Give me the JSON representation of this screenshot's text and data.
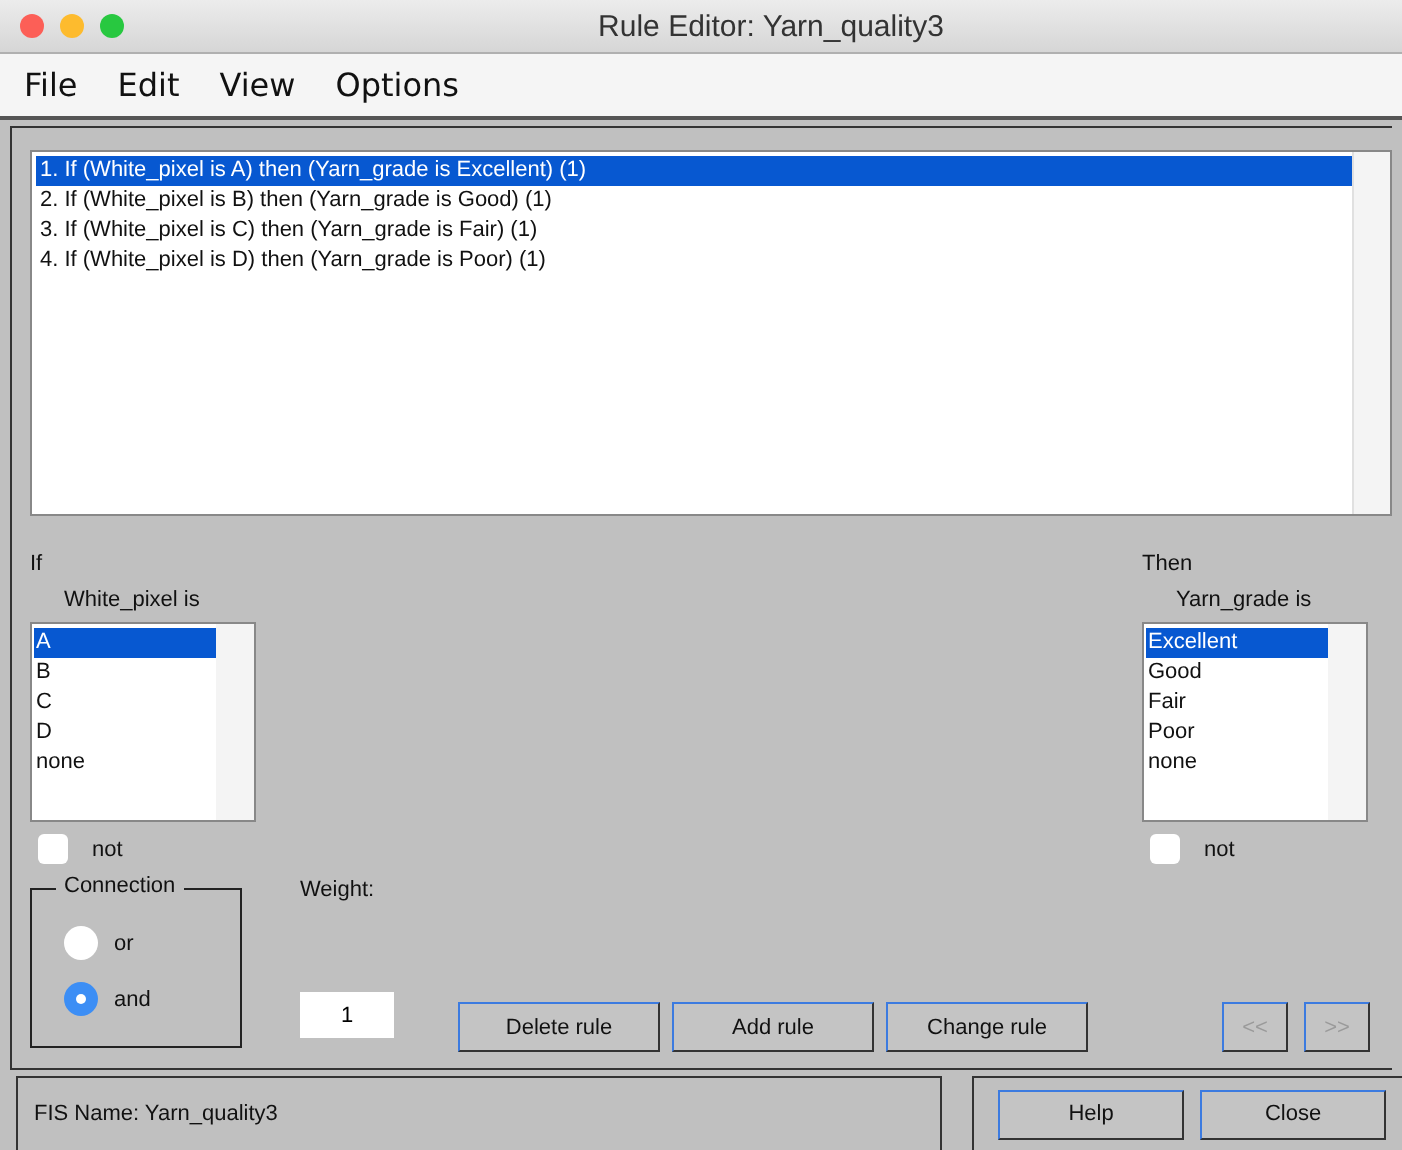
{
  "window": {
    "title": "Rule Editor: Yarn_quality3"
  },
  "menu": [
    "File",
    "Edit",
    "View",
    "Options"
  ],
  "rules": [
    {
      "text": "1. If (White_pixel is A) then (Yarn_grade is Excellent) (1)",
      "selected": true
    },
    {
      "text": "2. If (White_pixel is B) then (Yarn_grade is Good) (1)",
      "selected": false
    },
    {
      "text": "3. If (White_pixel is C) then (Yarn_grade is Fair) (1)",
      "selected": false
    },
    {
      "text": "4. If (White_pixel is D) then (Yarn_grade is Poor) (1)",
      "selected": false
    }
  ],
  "if_panel": {
    "heading": "If",
    "variable": "White_pixel is",
    "options": [
      {
        "label": "A",
        "selected": true
      },
      {
        "label": "B",
        "selected": false
      },
      {
        "label": "C",
        "selected": false
      },
      {
        "label": "D",
        "selected": false
      },
      {
        "label": "none",
        "selected": false
      }
    ],
    "not": {
      "label": "not",
      "checked": false
    }
  },
  "then_panel": {
    "heading": "Then",
    "variable": "Yarn_grade is",
    "options": [
      {
        "label": "Excellent",
        "selected": true
      },
      {
        "label": "Good",
        "selected": false
      },
      {
        "label": "Fair",
        "selected": false
      },
      {
        "label": "Poor",
        "selected": false
      },
      {
        "label": "none",
        "selected": false
      }
    ],
    "not": {
      "label": "not",
      "checked": false
    }
  },
  "connection": {
    "title": "Connection",
    "options": [
      {
        "label": "or",
        "selected": false
      },
      {
        "label": "and",
        "selected": true
      }
    ]
  },
  "weight": {
    "label": "Weight:",
    "value": "1"
  },
  "buttons": [
    {
      "label": "Delete rule",
      "disabled": false
    },
    {
      "label": "Add rule",
      "disabled": false
    },
    {
      "label": "Change rule",
      "disabled": false
    }
  ],
  "nav_buttons": [
    {
      "label": "<<",
      "disabled": true
    },
    {
      "label": ">>",
      "disabled": true
    }
  ],
  "status": "FIS Name: Yarn_quality3",
  "footer_buttons": [
    "Help",
    "Close"
  ]
}
